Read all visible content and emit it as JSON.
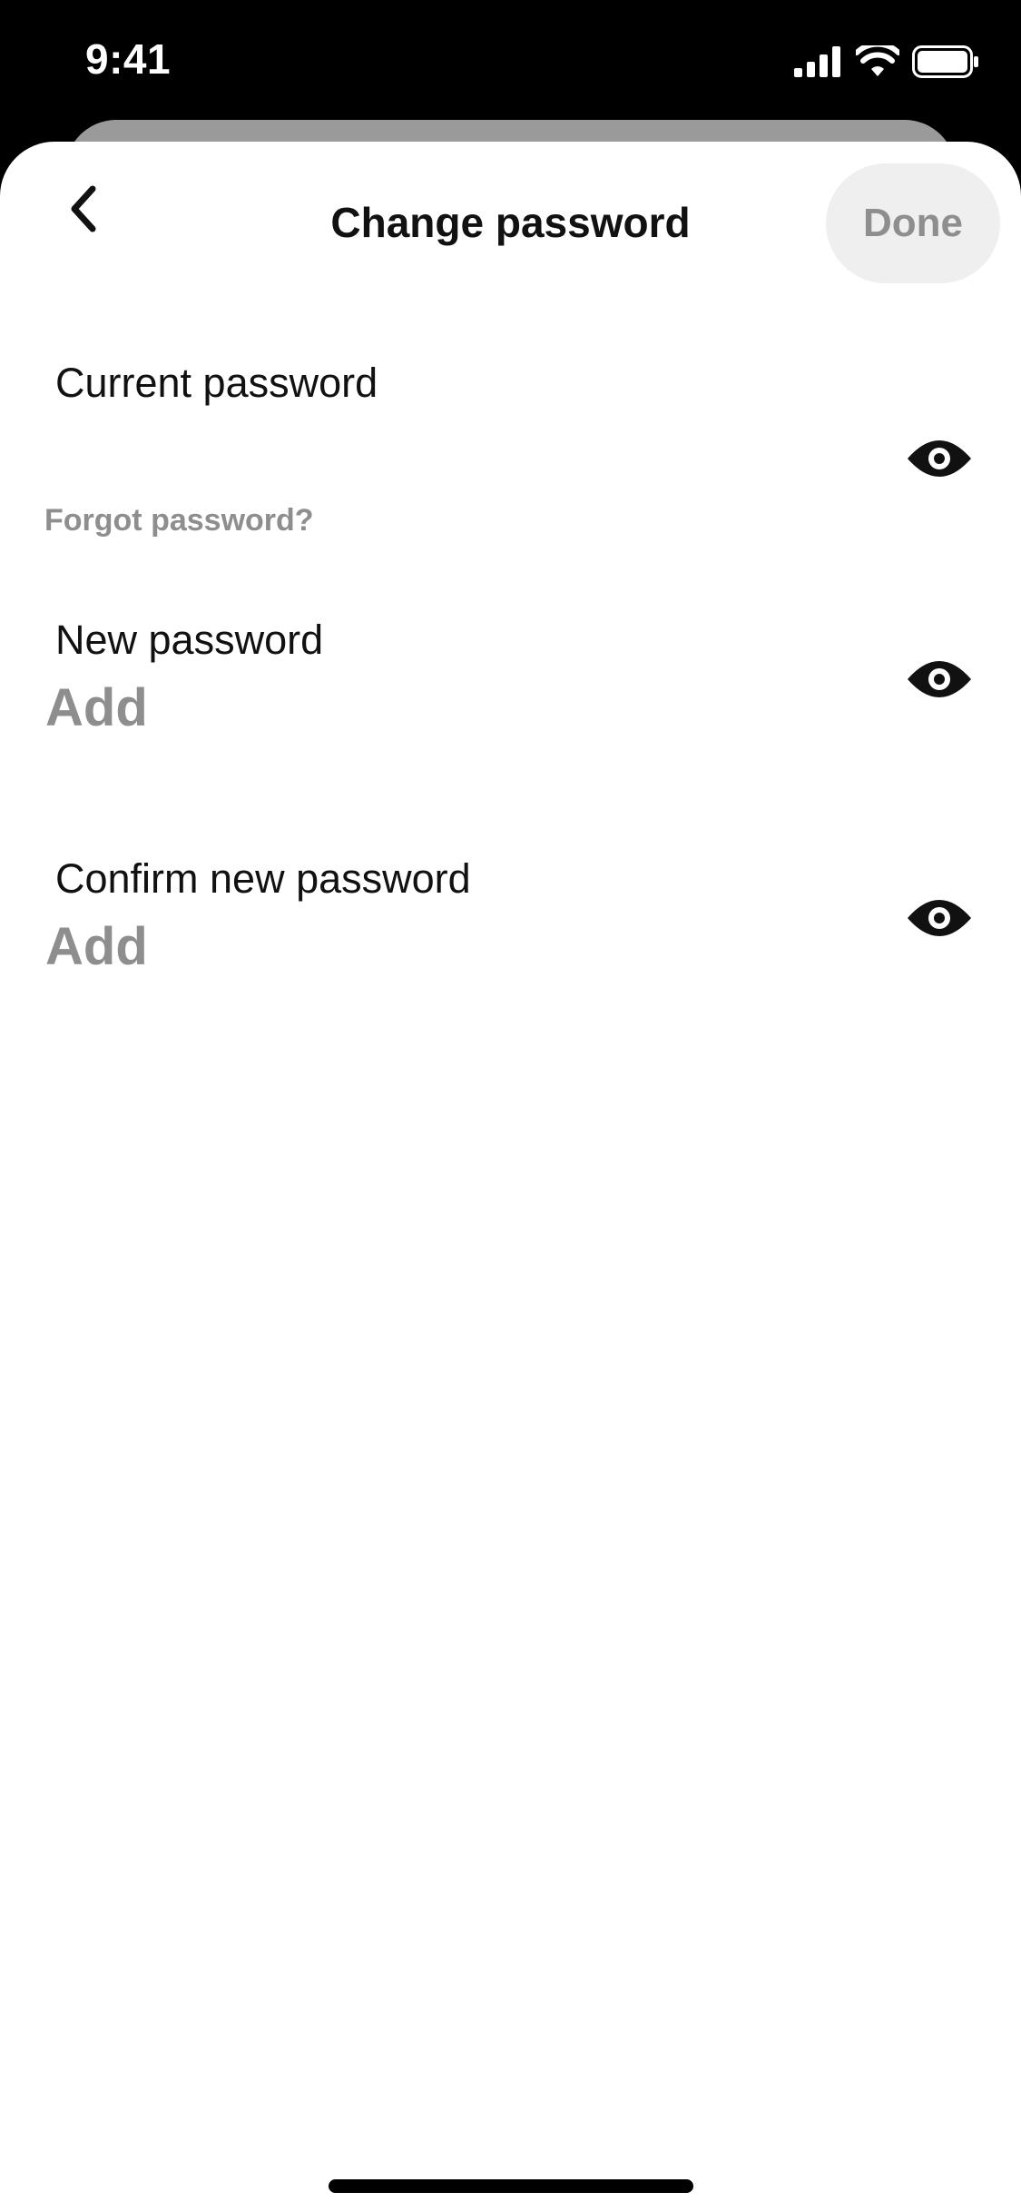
{
  "status_bar": {
    "time": "9:41",
    "icons": [
      "cellular-signal-icon",
      "wifi-icon",
      "battery-icon"
    ]
  },
  "nav": {
    "back_icon": "chevron-left-icon",
    "title": "Change password",
    "done_label": "Done"
  },
  "form": {
    "current_password": {
      "label": "Current password",
      "value": "",
      "placeholder": "",
      "toggle_icon": "eye-icon"
    },
    "forgot_password_label": "Forgot password?",
    "new_password": {
      "label": "New password",
      "value": "",
      "placeholder": "Add",
      "toggle_icon": "eye-icon"
    },
    "confirm_password": {
      "label": "Confirm new password",
      "value": "",
      "placeholder": "Add",
      "toggle_icon": "eye-icon"
    }
  },
  "colors": {
    "text_primary": "#111111",
    "text_secondary": "#8e8e8e",
    "done_button_bg": "#efefef",
    "sheet_bg": "#ffffff",
    "backdrop": "#000000",
    "stacked_card": "#9a9a9a"
  }
}
